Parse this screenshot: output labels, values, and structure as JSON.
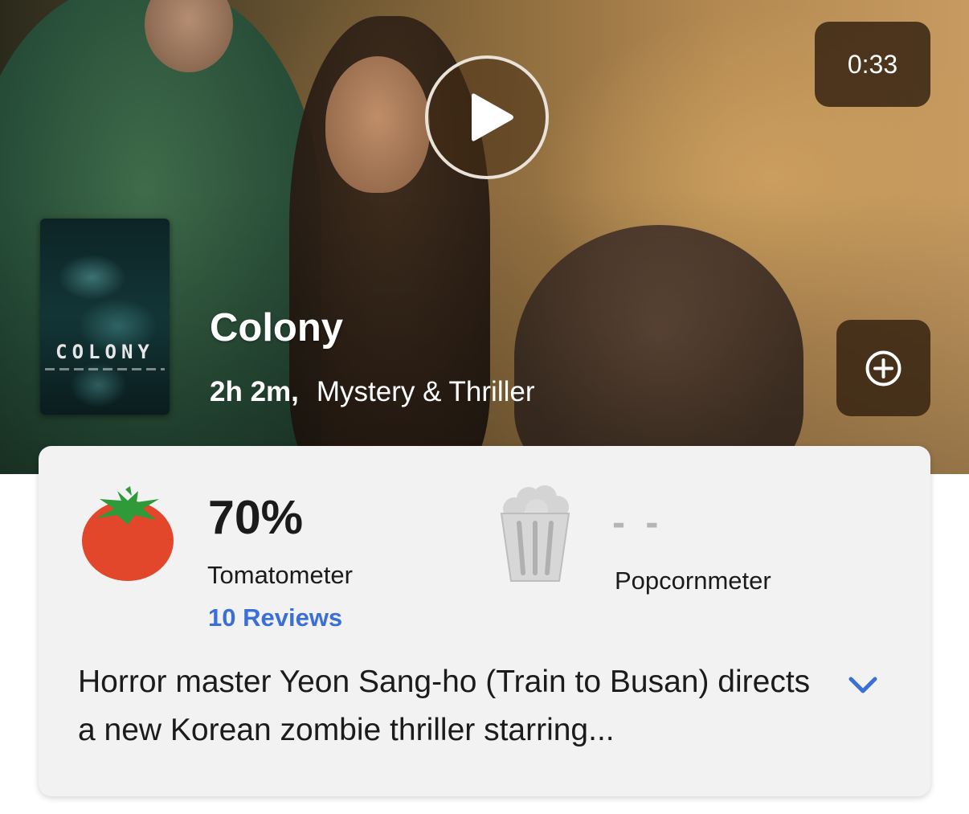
{
  "video": {
    "duration": "0:33"
  },
  "movie": {
    "poster_title": "COLONY",
    "title": "Colony",
    "runtime": "2h 2m,",
    "genre": "Mystery & Thriller"
  },
  "scores": {
    "tomatometer": {
      "value": "70%",
      "label": "Tomatometer",
      "reviews_link": "10 Reviews",
      "icon": "tomato-icon"
    },
    "popcornmeter": {
      "value": "- -",
      "label": "Popcornmeter",
      "icon": "popcorn-bucket-icon"
    }
  },
  "synopsis": {
    "text": "Horror master Yeon Sang-ho (Train to Busan) directs a new Korean zombie thriller starring...",
    "expand_icon": "chevron-down-icon"
  },
  "colors": {
    "tomato_red": "#e2472b",
    "stem_green": "#2f9a3a",
    "link_blue": "#3a6fd8",
    "card_bg": "#f2f2f2",
    "badge_bg": "#32200f"
  }
}
